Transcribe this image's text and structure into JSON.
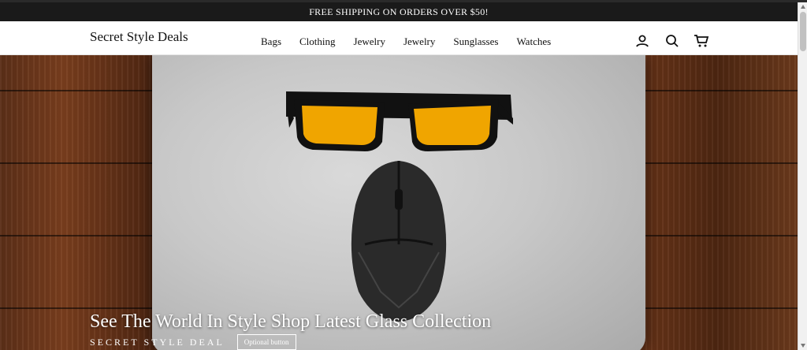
{
  "announcement": "FREE SHIPPING ON ORDERS OVER $50!",
  "header": {
    "logo": "Secret Style Deals",
    "nav": [
      "Bags",
      "Clothing",
      "Jewelry",
      "Jewelry",
      "Sunglasses",
      "Watches"
    ],
    "icons": [
      "account-icon",
      "search-icon",
      "cart-icon"
    ]
  },
  "hero": {
    "title": "See The World In Style Shop Latest Glass Collection",
    "subtitle": "SECRET STYLE DEAL",
    "button": "Optional button"
  },
  "colors": {
    "bar": "#1a1a1a",
    "header": "#ffffff",
    "lens": "#f0a500"
  }
}
